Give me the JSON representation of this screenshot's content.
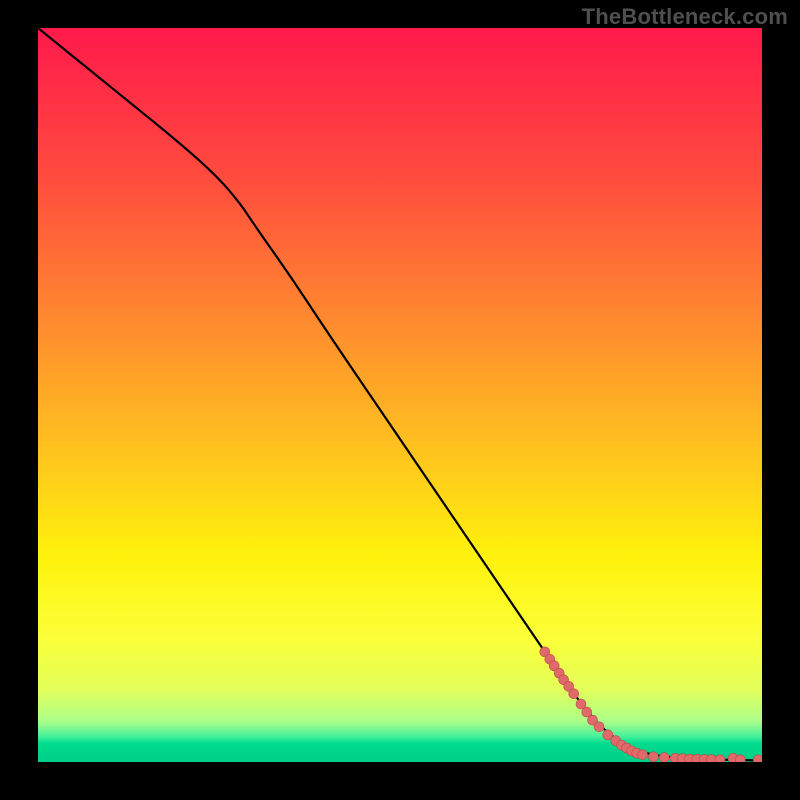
{
  "watermark": "TheBottleneck.com",
  "colors": {
    "line": "#000000",
    "point_fill": "#e06a6a",
    "point_stroke": "#bb4a4a",
    "page_bg": "#000000"
  },
  "chart_data": {
    "type": "line",
    "title": "",
    "xlabel": "",
    "ylabel": "",
    "xlim": [
      0,
      100
    ],
    "ylim": [
      0,
      100
    ],
    "gradient_stops": [
      {
        "offset": 0.0,
        "color": "#ff1a4b"
      },
      {
        "offset": 0.2,
        "color": "#ff4a3e"
      },
      {
        "offset": 0.4,
        "color": "#ff8a2f"
      },
      {
        "offset": 0.57,
        "color": "#ffc11f"
      },
      {
        "offset": 0.72,
        "color": "#fff20c"
      },
      {
        "offset": 0.83,
        "color": "#fbff38"
      },
      {
        "offset": 0.9,
        "color": "#e4ff5a"
      },
      {
        "offset": 0.945,
        "color": "#aaff8a"
      },
      {
        "offset": 0.965,
        "color": "#46f09a"
      },
      {
        "offset": 0.975,
        "color": "#00db8e"
      },
      {
        "offset": 1.0,
        "color": "#00cf87"
      }
    ],
    "curve": [
      {
        "x": 0.0,
        "y": 100.0
      },
      {
        "x": 10.0,
        "y": 92.0
      },
      {
        "x": 20.0,
        "y": 84.0
      },
      {
        "x": 25.0,
        "y": 79.5
      },
      {
        "x": 28.0,
        "y": 76.0
      },
      {
        "x": 30.0,
        "y": 73.0
      },
      {
        "x": 35.0,
        "y": 66.0
      },
      {
        "x": 40.0,
        "y": 58.5
      },
      {
        "x": 50.0,
        "y": 44.0
      },
      {
        "x": 60.0,
        "y": 29.5
      },
      {
        "x": 70.0,
        "y": 15.0
      },
      {
        "x": 76.0,
        "y": 6.5
      },
      {
        "x": 80.0,
        "y": 2.8
      },
      {
        "x": 84.0,
        "y": 1.0
      },
      {
        "x": 90.0,
        "y": 0.4
      },
      {
        "x": 100.0,
        "y": 0.2
      }
    ],
    "points": [
      {
        "x": 70.0,
        "y": 15.0
      },
      {
        "x": 70.7,
        "y": 14.0
      },
      {
        "x": 71.3,
        "y": 13.1
      },
      {
        "x": 72.0,
        "y": 12.1
      },
      {
        "x": 72.6,
        "y": 11.2
      },
      {
        "x": 73.3,
        "y": 10.3
      },
      {
        "x": 74.0,
        "y": 9.3
      },
      {
        "x": 75.0,
        "y": 7.9
      },
      {
        "x": 75.8,
        "y": 6.8
      },
      {
        "x": 76.6,
        "y": 5.7
      },
      {
        "x": 77.5,
        "y": 4.8
      },
      {
        "x": 78.7,
        "y": 3.7
      },
      {
        "x": 79.8,
        "y": 2.9
      },
      {
        "x": 80.6,
        "y": 2.3
      },
      {
        "x": 81.3,
        "y": 1.9
      },
      {
        "x": 82.0,
        "y": 1.5
      },
      {
        "x": 82.7,
        "y": 1.2
      },
      {
        "x": 83.5,
        "y": 1.0
      },
      {
        "x": 85.0,
        "y": 0.7
      },
      {
        "x": 86.5,
        "y": 0.6
      },
      {
        "x": 88.0,
        "y": 0.5
      },
      {
        "x": 89.0,
        "y": 0.45
      },
      {
        "x": 90.0,
        "y": 0.4
      },
      {
        "x": 91.0,
        "y": 0.38
      },
      {
        "x": 92.0,
        "y": 0.35
      },
      {
        "x": 93.0,
        "y": 0.33
      },
      {
        "x": 94.2,
        "y": 0.3
      },
      {
        "x": 96.0,
        "y": 0.5
      },
      {
        "x": 97.0,
        "y": 0.3
      },
      {
        "x": 99.5,
        "y": 0.3
      }
    ],
    "point_radius": 5.0
  }
}
